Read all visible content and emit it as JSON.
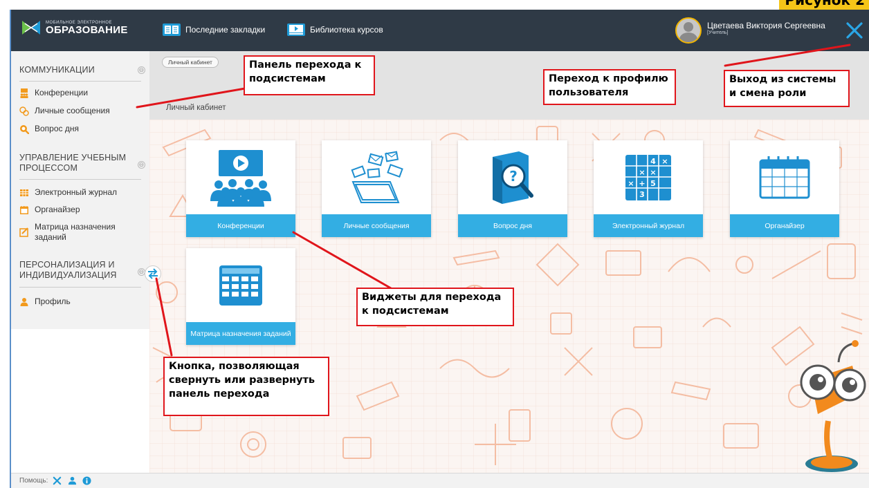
{
  "figure_label": "Рисунок 2",
  "header": {
    "logo_small": "МОБИЛЬНОЕ ЭЛЕКТРОННОЕ",
    "logo_big": "ОБРАЗОВАНИЕ",
    "bookmarks": "Последние закладки",
    "courses": "Библиотека курсов",
    "user_name": "Цветаева Виктория Сергеевна",
    "user_role": "[Учитель]",
    "close_icon": "close-icon"
  },
  "sidebar": {
    "sections": [
      {
        "title": "КОММУНИКАЦИИ",
        "items": [
          {
            "label": "Конференции",
            "icon": "conference-icon"
          },
          {
            "label": "Личные сообщения",
            "icon": "messages-icon"
          },
          {
            "label": "Вопрос дня",
            "icon": "question-search-icon"
          }
        ]
      },
      {
        "title": "УПРАВЛЕНИЕ УЧЕБНЫМ ПРОЦЕССОМ",
        "items": [
          {
            "label": "Электронный журнал",
            "icon": "journal-icon"
          },
          {
            "label": "Органайзер",
            "icon": "calendar-icon"
          },
          {
            "label": "Матрица назначения заданий",
            "icon": "assignment-icon"
          }
        ]
      },
      {
        "title": "ПЕРСОНАЛИЗАЦИЯ И ИНДИВИДУАЛИЗАЦИЯ",
        "items": [
          {
            "label": "Профиль",
            "icon": "person-icon"
          }
        ]
      }
    ],
    "toggle_symbol": "⊖"
  },
  "breadcrumb": "Личный кабинет",
  "page_title": "Личный кабинет",
  "tiles": [
    {
      "label": "Конференции",
      "icon": "conference-icon"
    },
    {
      "label": "Личные сообщения",
      "icon": "messages-laptop-icon"
    },
    {
      "label": "Вопрос дня",
      "icon": "question-book-icon"
    },
    {
      "label": "Электронный журнал",
      "icon": "journal-grid-icon"
    },
    {
      "label": "Органайзер",
      "icon": "calendar-icon"
    },
    {
      "label": "Матрица назначения заданий",
      "icon": "matrix-icon"
    }
  ],
  "footer": {
    "help": "Помощь:"
  },
  "annotations": {
    "nav_panel": "Панель перехода к подсистемам",
    "profile": "Переход к профилю пользователя",
    "logout": "Выход из системы и смена роли",
    "widgets": "Виджеты для перехода к подсистемам",
    "collapse": "Кнопка, позволяющая свернуть или развернуть панель перехода"
  },
  "colors": {
    "header_bg": "#2f3a46",
    "tile_caption": "#33aee3",
    "annotation_border": "#e0151b",
    "figure_label_bg": "#f5c518"
  }
}
